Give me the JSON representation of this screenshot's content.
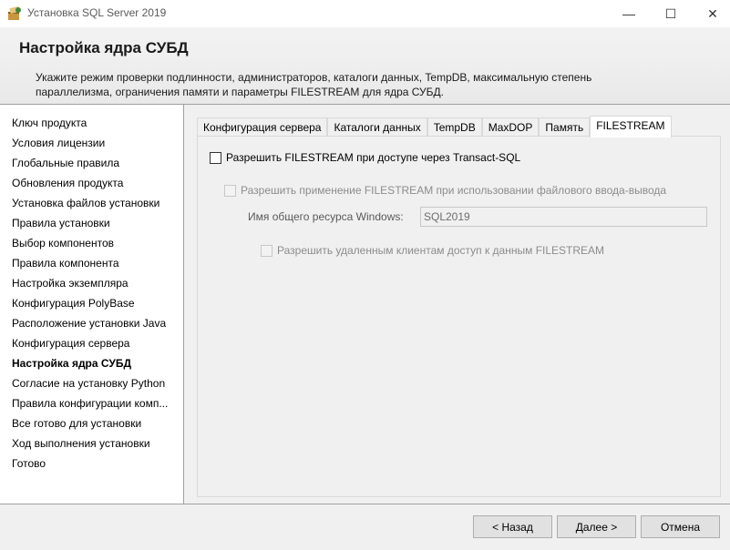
{
  "window": {
    "title": "Установка SQL Server 2019",
    "minimize_glyph": "—",
    "maximize_glyph": "☐",
    "close_glyph": "✕"
  },
  "header": {
    "title": "Настройка ядра СУБД",
    "description_line1": "Укажите режим проверки подлинности, администраторов, каталоги данных, TempDB, максимальную степень",
    "description_line2": "параллелизма, ограничения памяти и параметры FILESTREAM для ядра СУБД."
  },
  "sidebar": {
    "items": [
      {
        "label": "Ключ продукта"
      },
      {
        "label": "Условия лицензии"
      },
      {
        "label": "Глобальные правила"
      },
      {
        "label": "Обновления продукта"
      },
      {
        "label": "Установка файлов установки"
      },
      {
        "label": "Правила установки"
      },
      {
        "label": "Выбор компонентов"
      },
      {
        "label": "Правила компонента"
      },
      {
        "label": "Настройка экземпляра"
      },
      {
        "label": "Конфигурация PolyBase"
      },
      {
        "label": "Расположение установки Java"
      },
      {
        "label": "Конфигурация сервера"
      },
      {
        "label": "Настройка ядра СУБД"
      },
      {
        "label": "Согласие на установку Python"
      },
      {
        "label": "Правила конфигурации комп..."
      },
      {
        "label": "Все готово для установки"
      },
      {
        "label": "Ход выполнения установки"
      },
      {
        "label": "Готово"
      }
    ],
    "active_index": 12
  },
  "tabs": [
    {
      "label": "Конфигурация сервера"
    },
    {
      "label": "Каталоги данных"
    },
    {
      "label": "TempDB"
    },
    {
      "label": "MaxDOP"
    },
    {
      "label": "Память"
    },
    {
      "label": "FILESTREAM"
    }
  ],
  "filestream": {
    "enable_tsql_label": "Разрешить FILESTREAM при доступе через Transact-SQL",
    "enable_file_io_label": "Разрешить применение FILESTREAM при использовании файлового ввода-вывода",
    "share_name_label": "Имя общего ресурса Windows:",
    "share_name_value": "SQL2019",
    "enable_remote_label": "Разрешить удаленным клиентам доступ к данным FILESTREAM"
  },
  "footer": {
    "back_label": "< Назад",
    "next_label": "Далее >",
    "cancel_label": "Отмена"
  }
}
